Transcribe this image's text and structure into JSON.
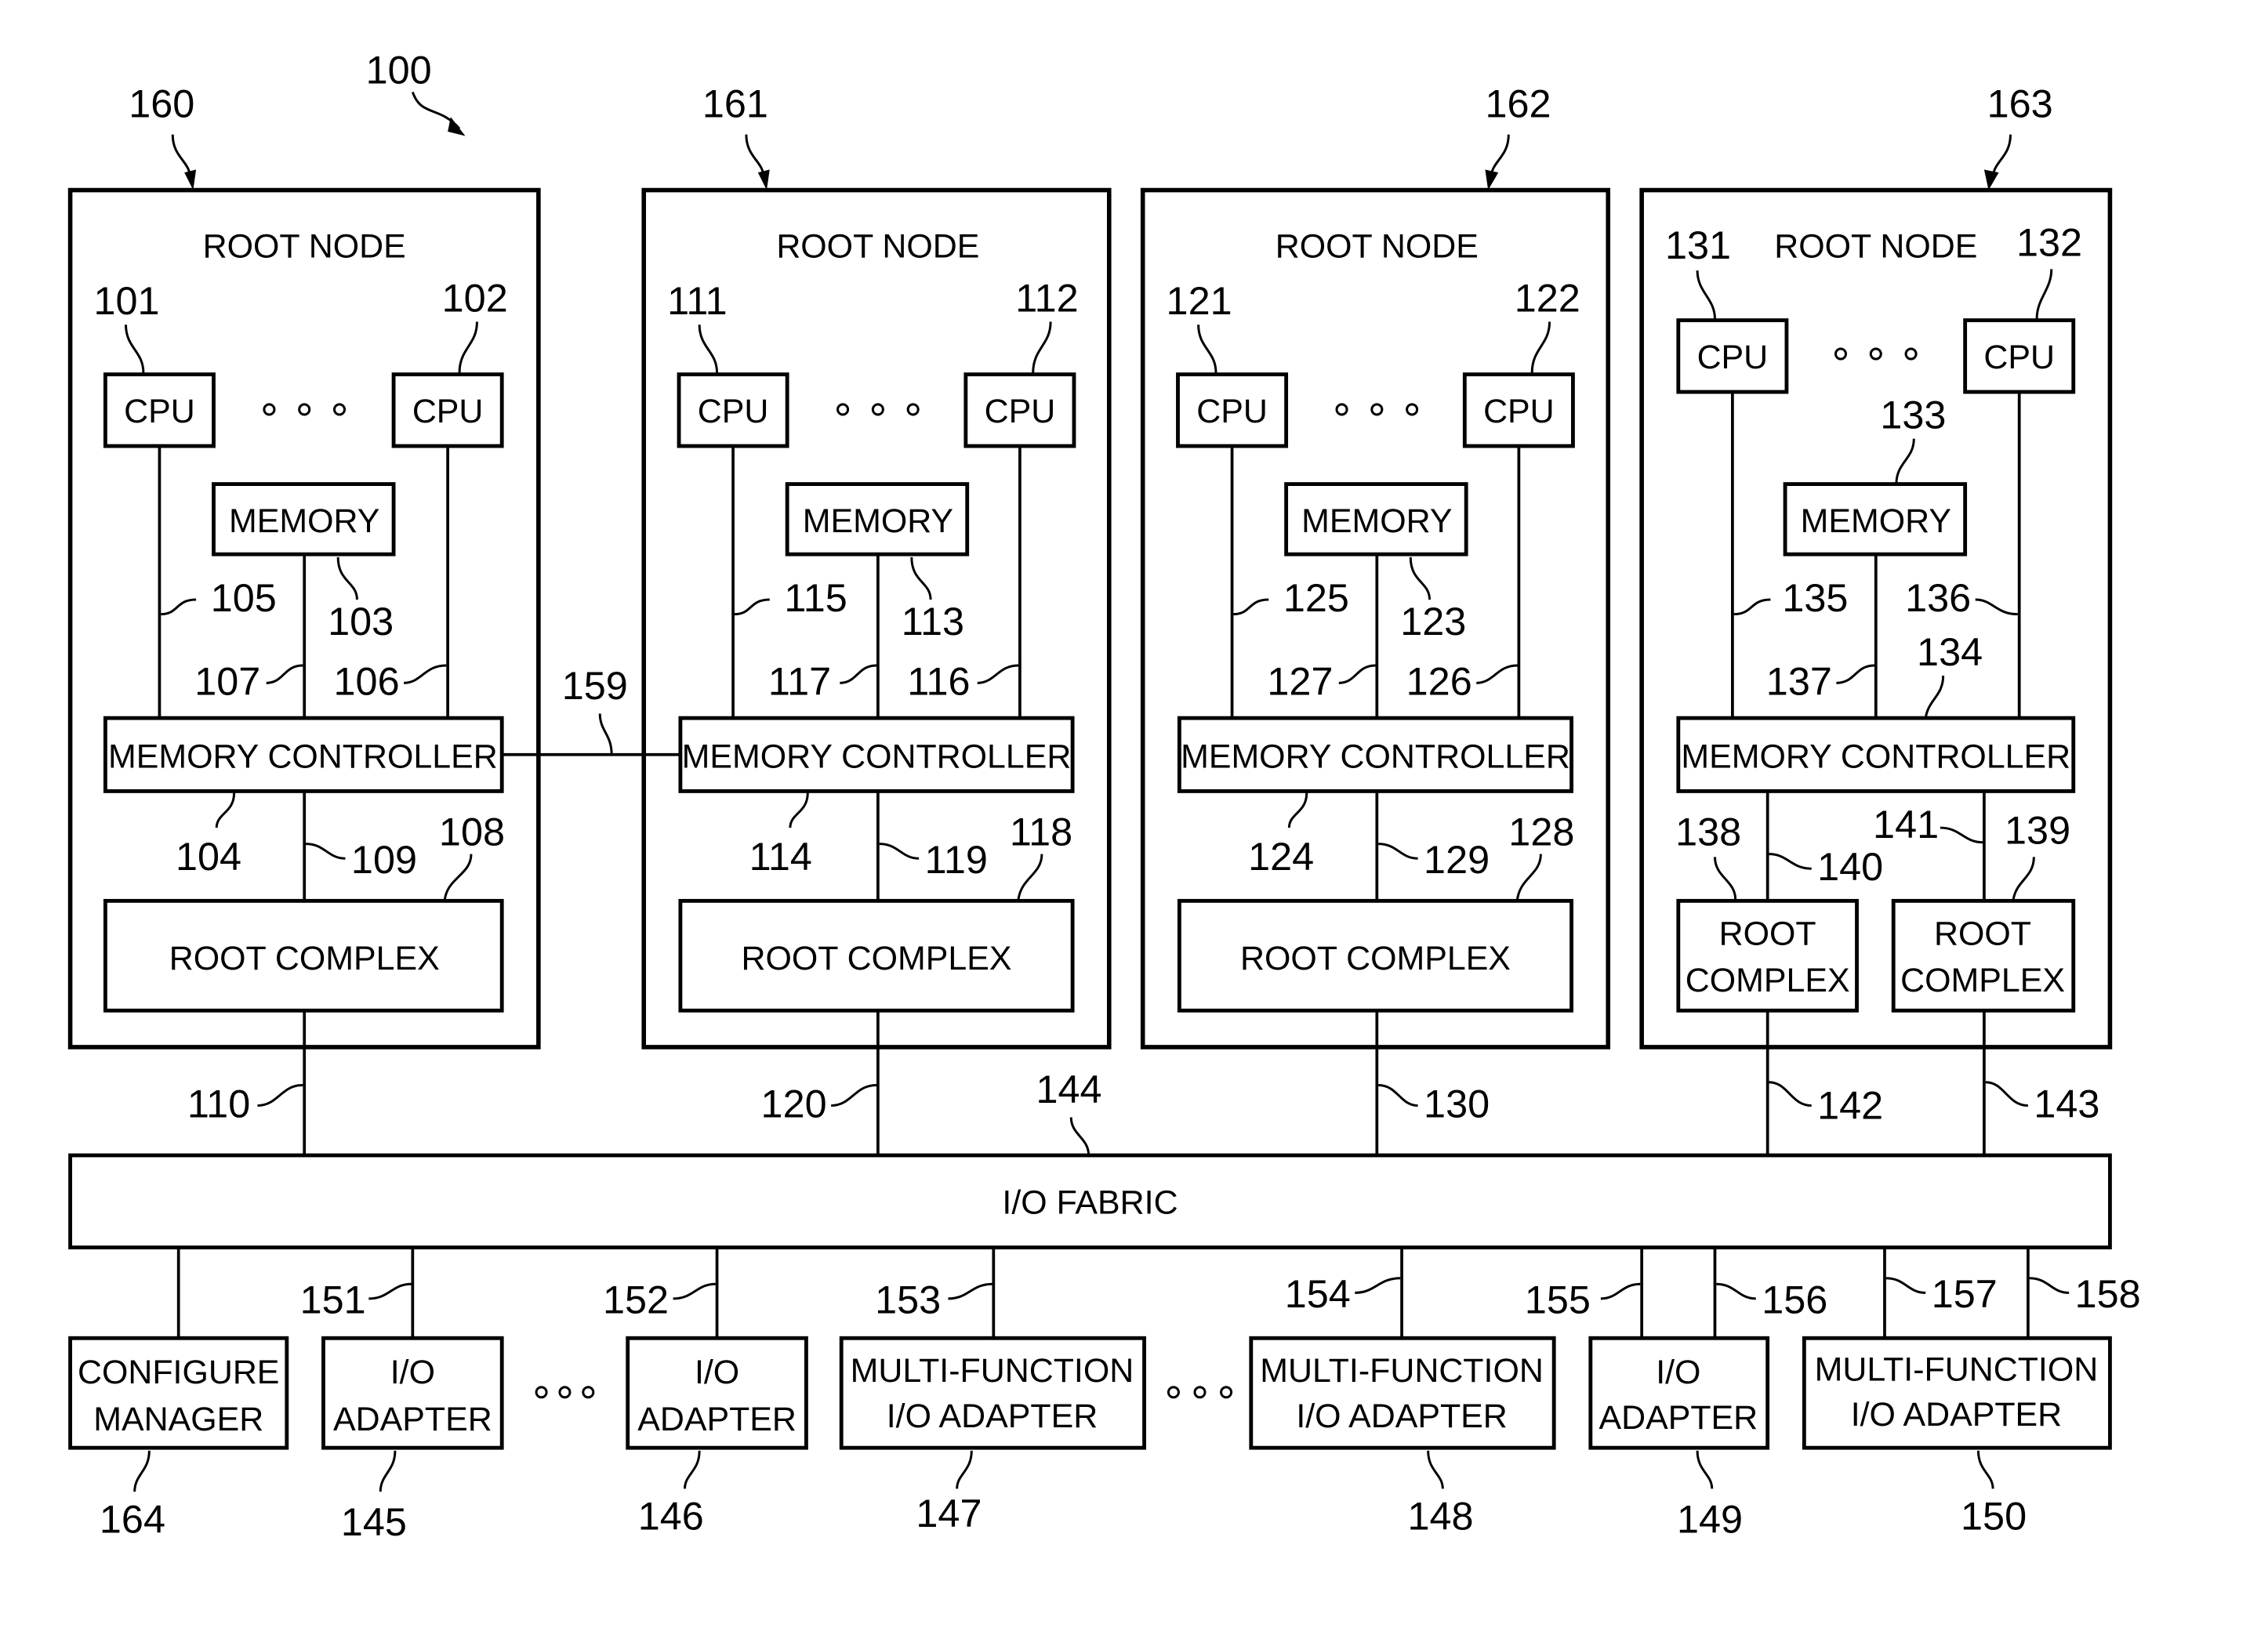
{
  "figure": {
    "ref": "100",
    "root_node_label": "ROOT NODE",
    "cpu_label": "CPU",
    "memory_label": "MEMORY",
    "memory_controller_label": "MEMORY CONTROLLER",
    "root_complex_label": "ROOT COMPLEX",
    "root_complex_split": [
      "ROOT",
      "COMPLEX"
    ],
    "io_fabric_label": "I/O FABRIC",
    "io_fabric_ref": "144",
    "link_ref": "159"
  },
  "nodes": [
    {
      "ref": "160",
      "cpu_a": "101",
      "cpu_b": "102",
      "mem": "103",
      "mc": "104",
      "bus_a": "105",
      "bus_b": "106",
      "bus_m": "107",
      "rc": "108",
      "rc_link": "109",
      "fabric_link": "110"
    },
    {
      "ref": "161",
      "cpu_a": "111",
      "cpu_b": "112",
      "mem": "113",
      "mc": "114",
      "bus_a": "115",
      "bus_b": "116",
      "bus_m": "117",
      "rc": "118",
      "rc_link": "119",
      "fabric_link": "120"
    },
    {
      "ref": "162",
      "cpu_a": "121",
      "cpu_b": "122",
      "mem": "123",
      "mc": "124",
      "bus_a": "125",
      "bus_b": "126",
      "bus_m": "127",
      "rc": "128",
      "rc_link": "129",
      "fabric_link": "130"
    },
    {
      "ref": "163",
      "cpu_a": "131",
      "cpu_b": "132",
      "mem": "133",
      "mc": "134",
      "bus_a": "135",
      "bus_b": "136",
      "bus_m": "137",
      "rc_a": "138",
      "rc_b": "139",
      "rc_link_a": "140",
      "rc_link_b": "141",
      "fabric_link_a": "142",
      "fabric_link_b": "143"
    }
  ],
  "adapters": [
    {
      "lines": [
        "CONFIGURE",
        "MANAGER"
      ],
      "ref": "164",
      "link": ""
    },
    {
      "lines": [
        "I/O",
        "ADAPTER"
      ],
      "ref": "145",
      "link": "151"
    },
    {
      "lines": [
        "I/O",
        "ADAPTER"
      ],
      "ref": "146",
      "link": "152"
    },
    {
      "lines": [
        "MULTI-FUNCTION",
        "I/O ADAPTER"
      ],
      "ref": "147",
      "link": "153"
    },
    {
      "lines": [
        "MULTI-FUNCTION",
        "I/O ADAPTER"
      ],
      "ref": "148",
      "link": "154"
    },
    {
      "lines": [
        "I/O",
        "ADAPTER"
      ],
      "ref": "149",
      "link_a": "155",
      "link_b": "156"
    },
    {
      "lines": [
        "MULTI-FUNCTION",
        "I/O ADAPTER"
      ],
      "ref": "150",
      "link_a": "157",
      "link_b": "158"
    }
  ]
}
